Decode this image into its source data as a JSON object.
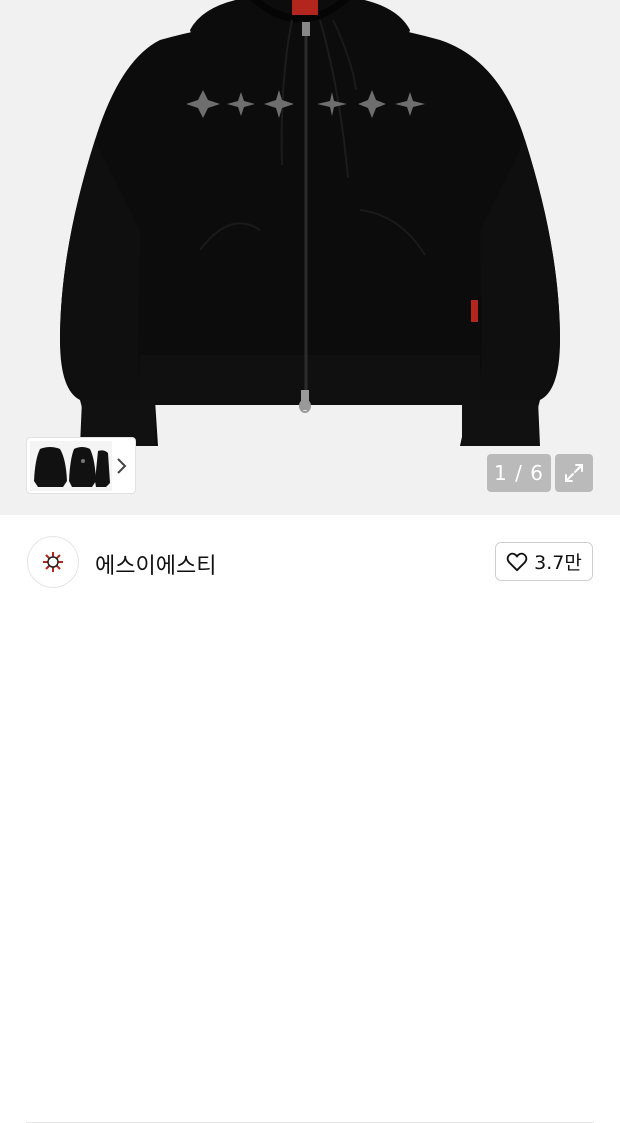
{
  "gallery": {
    "counter": "1 / 6",
    "thumbnail_icons": [
      "hoodie-front-thumbnail",
      "hoodie-back-thumbnail",
      "hoodie-side-thumbnail"
    ],
    "next_icon": "chevron-right-icon",
    "expand_icon": "expand-icon"
  },
  "shop": {
    "name": "에스이에스티",
    "logo_icon": "sun-burst-logo-icon",
    "like_icon": "heart-outline-icon",
    "like_count": "3.7만"
  },
  "colors": {
    "gallery_bg": "#f1f1f1",
    "hoodie": "#0c0c0c",
    "overlay": "#8c8c8c",
    "logo_red": "#b3261e"
  }
}
